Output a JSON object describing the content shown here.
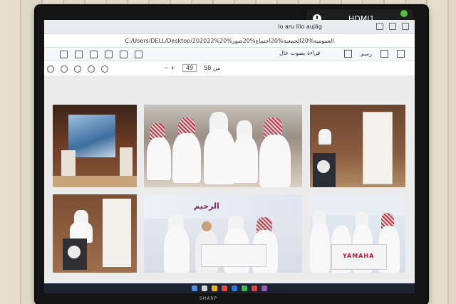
{
  "monitor": {
    "input_label": "HDMI1",
    "brand": "SHARP"
  },
  "browser": {
    "tab_title": "lo aru lilo aujäg",
    "file_path": "C:/Users/DELL/Desktop/202022%العمومية%20الجمعية%20اجتماع%20صور%20",
    "read_aloud": "قراءة بصوت عال",
    "draw_label": "رسم",
    "page_current": "49",
    "page_total": "من 58",
    "zoom": "−  +"
  },
  "document": {
    "photo_banners": [
      {
        "text": "الرحيم",
        "position": "center-banner"
      }
    ],
    "yamaha_label": "YAMAHA"
  },
  "colors": {
    "screen_bg": "#f4f5f7",
    "bezel": "#141414",
    "status_led": "#51c13b",
    "banner_accent": "#7a2d5a",
    "yamaha_red": "#c4122f"
  }
}
